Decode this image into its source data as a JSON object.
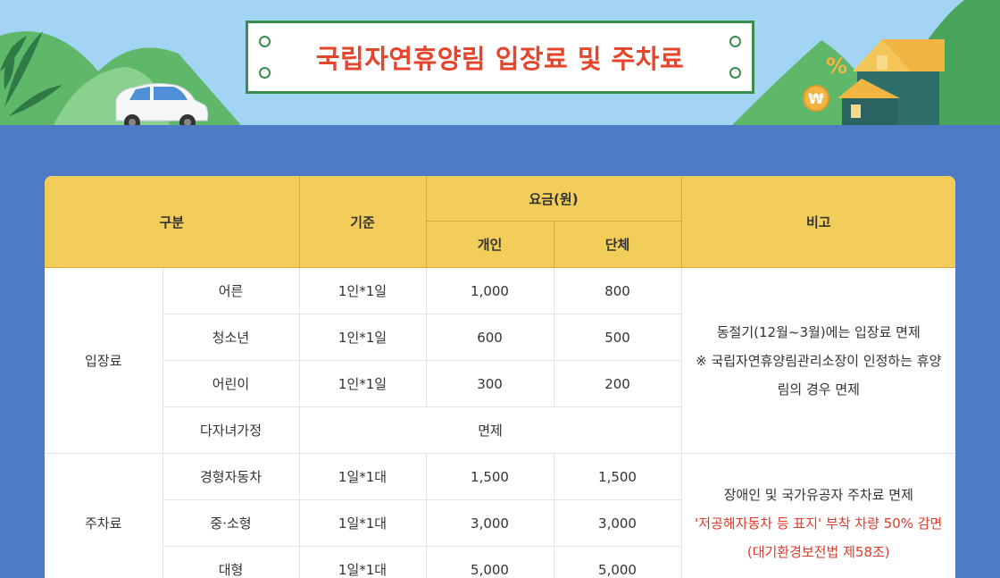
{
  "banner": {
    "title": "국립자연휴양림 입장료 및 주차료",
    "icons": [
      "car-icon",
      "house-icon",
      "percent-icon",
      "won-coin-icon",
      "leaf-icon",
      "mountain-icon"
    ],
    "percent_symbol": "%",
    "won_symbol": "₩"
  },
  "colors": {
    "background": "#4f7bc6",
    "sky": "#a4d4f4",
    "header": "#f3cd5a",
    "title_red": "#e6452b",
    "title_border": "#3b8d4d",
    "note_red": "#e23a2a"
  },
  "table": {
    "headers": {
      "category": "구분",
      "standard": "기준",
      "fee": "요금(원)",
      "individual": "개인",
      "group": "단체",
      "remarks": "비고"
    },
    "admission": {
      "label": "입장료",
      "rows": [
        {
          "type": "어른",
          "standard": "1인*1일",
          "individual": "1,000",
          "group": "800"
        },
        {
          "type": "청소년",
          "standard": "1인*1일",
          "individual": "600",
          "group": "500"
        },
        {
          "type": "어린이",
          "standard": "1인*1일",
          "individual": "300",
          "group": "200"
        }
      ],
      "multi_child": {
        "type": "다자녀가정",
        "value": "면제"
      },
      "note_line1": "동절기(12월~3월)에는 입장료 면제",
      "note_line2": "※ 국립자연휴양림관리소장이 인정하는 휴양림의 경우 면제"
    },
    "parking": {
      "label": "주차료",
      "rows": [
        {
          "type": "경형자동차",
          "standard": "1일*1대",
          "individual": "1,500",
          "group": "1,500"
        },
        {
          "type": "중·소형",
          "standard": "1일*1대",
          "individual": "3,000",
          "group": "3,000"
        },
        {
          "type": "대형",
          "standard": "1일*1대",
          "individual": "5,000",
          "group": "5,000"
        }
      ],
      "note_line1": "장애인 및 국가유공자 주차료 면제",
      "note_line2": "'저공해자동차 등 표지' 부착 차량 50% 감면",
      "note_line3": "(대기환경보전법 제58조)"
    }
  }
}
